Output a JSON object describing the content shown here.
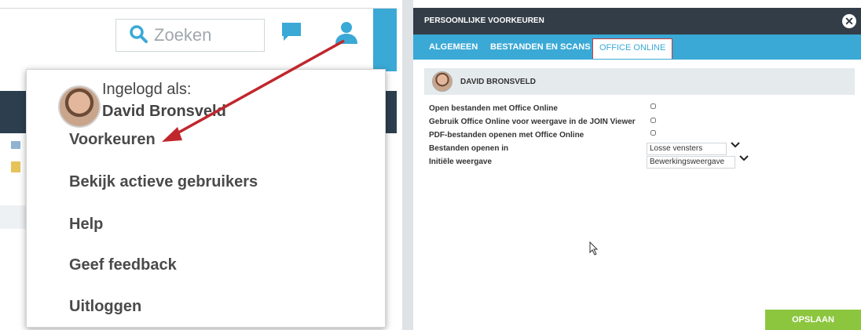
{
  "left": {
    "search": {
      "placeholder": "Zoeken"
    },
    "user_menu": {
      "logged_in_label": "Ingelogd als:",
      "user_name": "David Bronsveld",
      "items": [
        {
          "label": "Voorkeuren"
        },
        {
          "label": "Bekijk actieve gebruikers"
        },
        {
          "label": "Help"
        },
        {
          "label": "Geef feedback"
        },
        {
          "label": "Uitloggen"
        }
      ]
    }
  },
  "dialog": {
    "title": "PERSOONLIJKE VOORKEUREN",
    "close_glyph": "✕",
    "tabs": [
      {
        "label": "ALGEMEEN",
        "active": false
      },
      {
        "label": "BESTANDEN EN SCANS",
        "active": false
      },
      {
        "label": "OFFICE ONLINE",
        "active": true
      }
    ],
    "user_name": "DAVID BRONSVELD",
    "settings": [
      {
        "label": "Open bestanden met Office Online",
        "type": "checkbox",
        "checked": false
      },
      {
        "label": "Gebruik Office Online voor weergave in de JOIN Viewer",
        "type": "checkbox",
        "checked": false
      },
      {
        "label": "PDF-bestanden openen met Office Online",
        "type": "checkbox",
        "checked": false
      },
      {
        "label": "Bestanden openen in",
        "type": "select",
        "value": "Losse vensters"
      },
      {
        "label": "Initiële weergave",
        "type": "select",
        "value": "Bewerkingsweergave"
      }
    ],
    "save_label": "OPSLAAN"
  },
  "colors": {
    "accent_cyan": "#3aa9d6",
    "title_bar": "#333d47",
    "save_green": "#8cc63f",
    "annotation_red": "#c0272d"
  },
  "icons": [
    "search-icon",
    "chat-icon",
    "user-icon",
    "close-icon",
    "chevron-down-icon",
    "mouse-cursor-icon"
  ]
}
